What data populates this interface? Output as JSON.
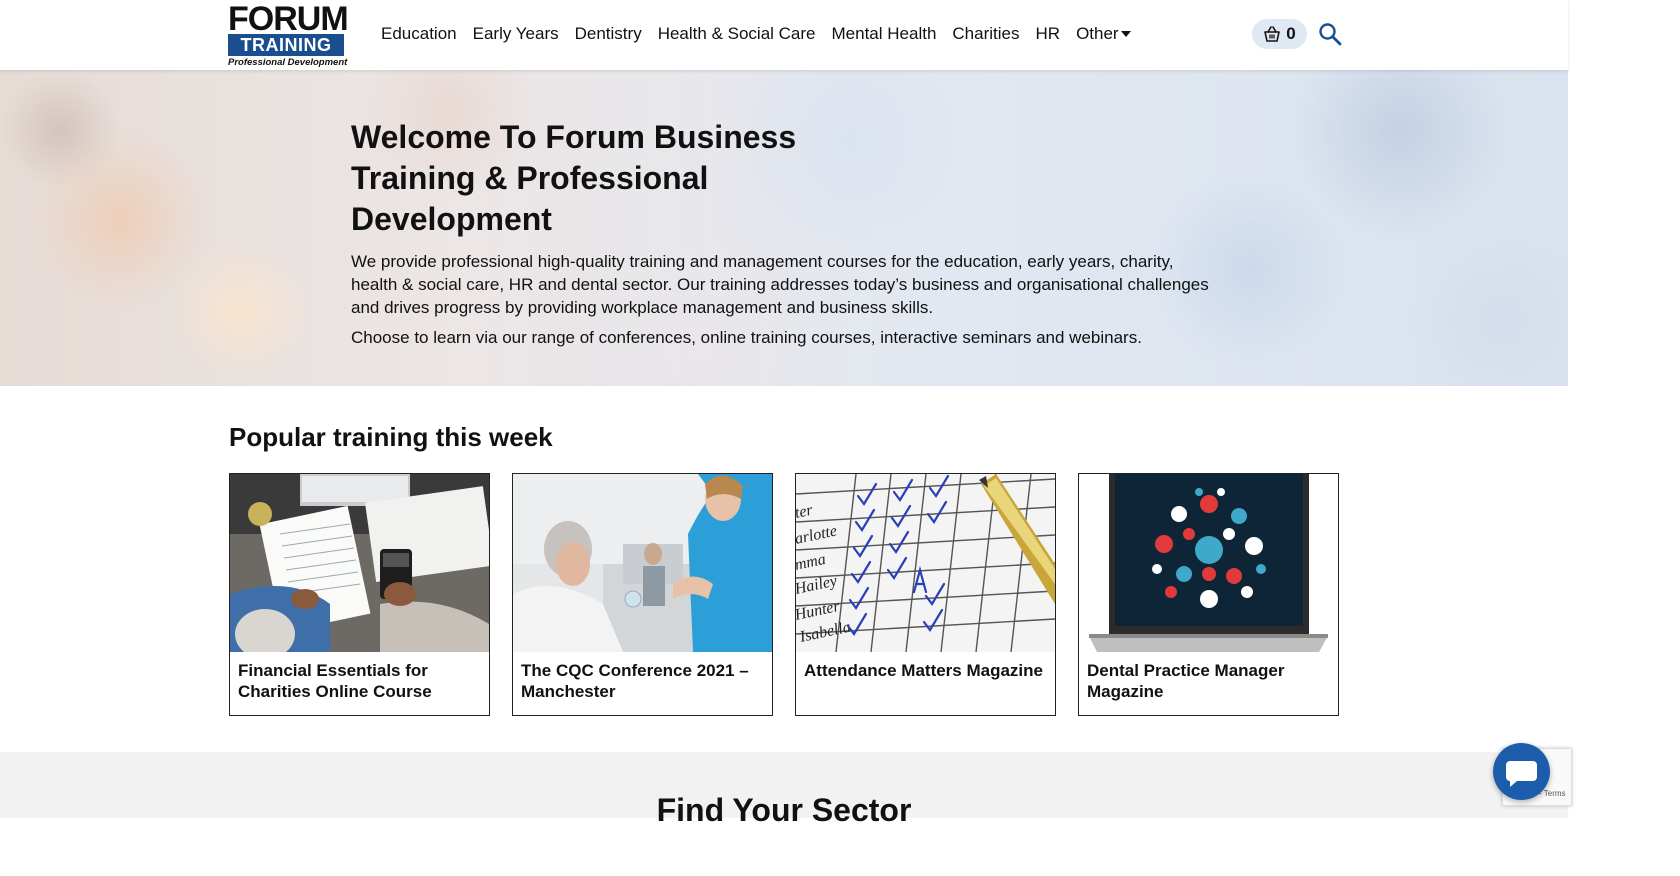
{
  "header": {
    "logo": {
      "line1": "FORUM",
      "line2": "TRAINING",
      "line3": "Professional Development"
    },
    "nav": [
      "Education",
      "Early Years",
      "Dentistry",
      "Health & Social Care",
      "Mental Health",
      "Charities",
      "HR"
    ],
    "nav_other": "Other",
    "cart_count": "0"
  },
  "hero": {
    "title": "Welcome To Forum Business Training & Professional Development",
    "p1": "We provide professional high-quality training and management courses for the education, early years, charity, health & social care, HR and dental sector. Our training addresses today’s business and organisational challenges and drives progress by providing workplace management and business skills.",
    "p2": "Choose to learn via our range of conferences, online training courses, interactive seminars and webinars."
  },
  "popular": {
    "heading": "Popular training this week",
    "cards": [
      {
        "title": "Financial Essentials for Charities Online Course"
      },
      {
        "title": "The CQC Conference 2021 – Manchester"
      },
      {
        "title": "Attendance Matters Magazine"
      },
      {
        "title": "Dental Practice Manager Magazine"
      }
    ]
  },
  "sector": {
    "heading": "Find Your Sector"
  },
  "recaptcha": {
    "label": "- Terms"
  },
  "colors": {
    "brand_blue": "#1a4f8f",
    "cart_bg": "#dfe9f3",
    "chat_blue": "#1b5dab"
  }
}
